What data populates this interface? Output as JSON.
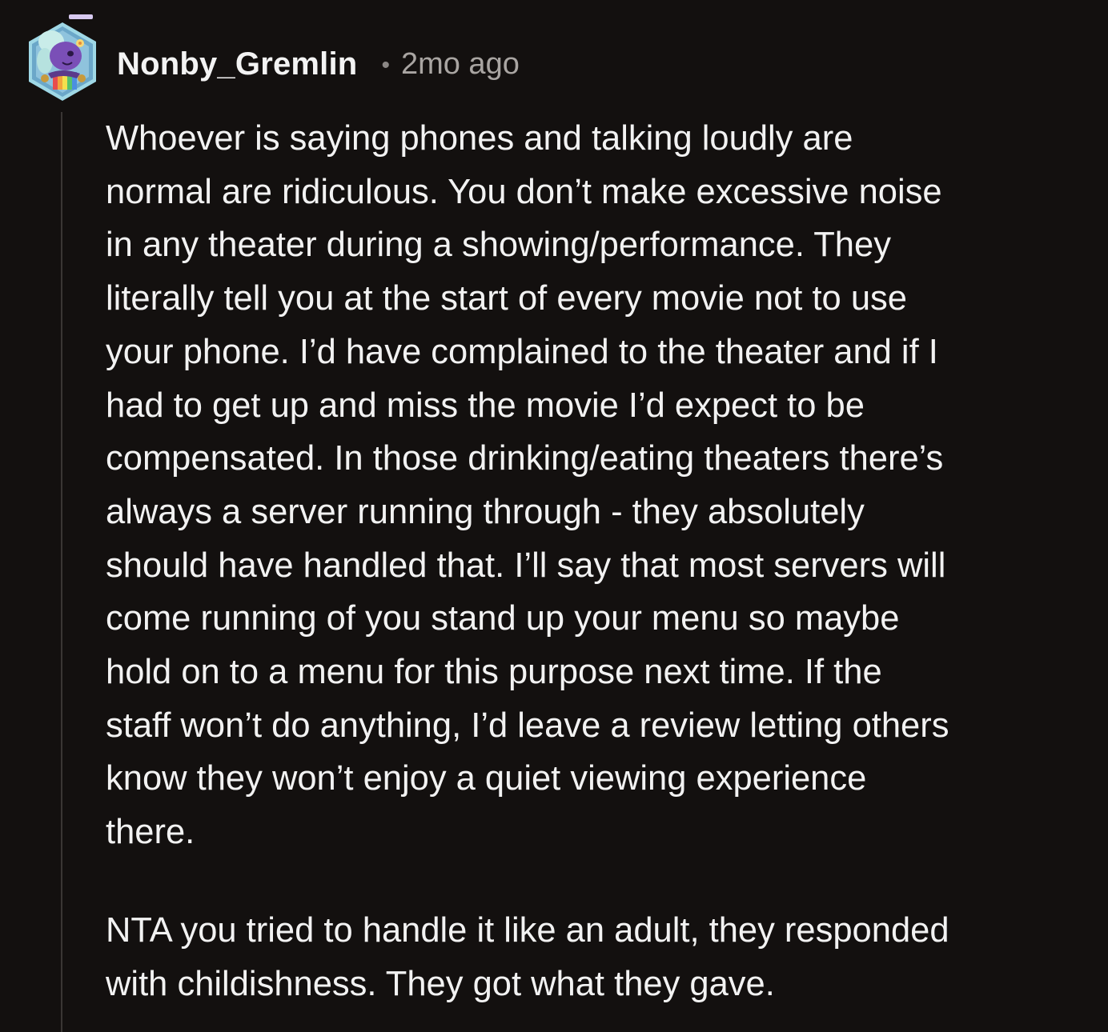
{
  "comment": {
    "author": "Nonby_Gremlin",
    "separator": "•",
    "timestamp": "2mo ago",
    "paragraphs": [
      "Whoever is saying phones and talking loudly are\nnormal are ridiculous. You don’t make excessive noise\nin any theater during a showing/performance. They\nliterally tell you at the start of every movie not to use\nyour phone. I’d have complained to the theater and if I\nhad to get up and miss the movie I’d expect to be\ncompensated. In those drinking/eating theaters there’s\nalways a server running through - they absolutely\nshould have handled that. I’ll say that most servers will\ncome running of you stand up your menu so maybe\nhold on to a menu for this purpose next time. If the\nstaff won’t do anything, I’d leave a review letting others\nknow they won’t enjoy a quiet viewing experience\nthere.",
      "NTA you tried to handle it like an adult, they responded\nwith childishness. They got what they gave."
    ]
  },
  "avatar": {
    "icon": "snoo-avatar-icon"
  },
  "colors": {
    "background": "#13100f",
    "text": "#f2f2f2",
    "muted": "#a9a5a2",
    "thread_line": "#3a3634"
  }
}
